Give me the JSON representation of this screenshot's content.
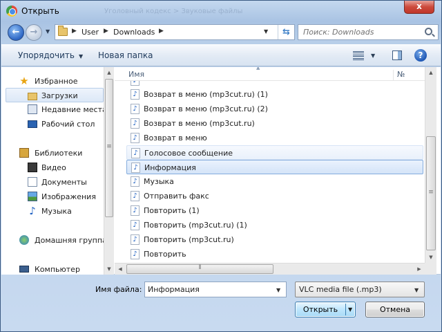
{
  "window": {
    "title": "Открыть",
    "ghost_title": "Уголовный кодекс > Звуковые файлы",
    "close_glyph": "x"
  },
  "address_bar": {
    "crumbs": [
      "User",
      "Downloads"
    ],
    "search_placeholder": "Поиск: Downloads"
  },
  "toolbar": {
    "organize_label": "Упорядочить",
    "new_folder_label": "Новая папка",
    "help_glyph": "?"
  },
  "nav_pane": {
    "favorites_header": "Избранное",
    "favorites": [
      "Загрузки",
      "Недавние места",
      "Рабочий стол"
    ],
    "libraries_header": "Библиотеки",
    "libraries": [
      "Видео",
      "Документы",
      "Изображения",
      "Музыка"
    ],
    "homegroup": "Домашняя группа",
    "computer": "Компьютер",
    "selected": "Загрузки"
  },
  "file_list": {
    "columns": {
      "name": "Имя",
      "number": "№"
    },
    "files": [
      "Возврат в меню (mp3cut.ru) (1)",
      "Возврат в меню (mp3cut.ru) (2)",
      "Возврат в меню (mp3cut.ru)",
      "Возврат в меню",
      "Голосовое сообщение",
      "Информация",
      "Музыка",
      "Отправить факс",
      "Повторить (1)",
      "Повторить (mp3cut.ru) (1)",
      "Повторить (mp3cut.ru)",
      "Повторить"
    ],
    "selected": "Информация",
    "hover": "Голосовое сообщение"
  },
  "bottom": {
    "filename_label": "Имя файла:",
    "filename_value": "Информация",
    "filetype_value": "VLC media file (.mp3)",
    "open_label": "Открыть",
    "cancel_label": "Отмена"
  },
  "colors": {
    "selection_border": "#84acdd",
    "close_button": "#cc4a3c",
    "link_text": "#1e395b"
  }
}
